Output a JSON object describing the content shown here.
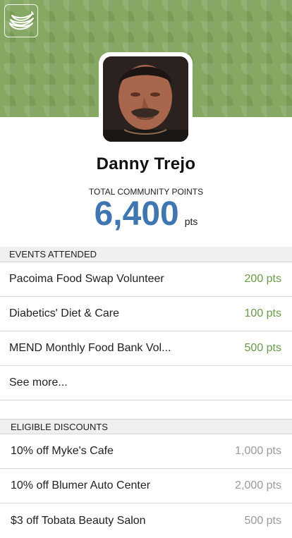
{
  "profile": {
    "name": "Danny Trejo",
    "points_label": "TOTAL COMMUNITY POINTS",
    "points_value": "6,400",
    "points_unit": "pts"
  },
  "events": {
    "header": "EVENTS ATTENDED",
    "items": [
      {
        "label": "Pacoima Food Swap Volunteer",
        "points": "200 pts"
      },
      {
        "label": "Diabetics' Diet & Care",
        "points": "100 pts"
      },
      {
        "label": "MEND Monthly Food Bank Vol...",
        "points": "500 pts"
      }
    ],
    "see_more": "See more..."
  },
  "discounts": {
    "header": "ELIGIBLE DISCOUNTS",
    "items": [
      {
        "label": "10% off Myke's Cafe",
        "points": "1,000 pts"
      },
      {
        "label": "10% off Blumer Auto Center",
        "points": "2,000 pts"
      },
      {
        "label": "$3 off Tobata Beauty Salon",
        "points": "500 pts"
      }
    ]
  },
  "colors": {
    "banner": "#86a862",
    "points_blue": "#3f75b0",
    "event_points_green": "#6a9a4a",
    "discount_points_grey": "#9a9a9a"
  },
  "icons": {
    "logo": "banana-icon",
    "avatar": "profile-photo"
  }
}
